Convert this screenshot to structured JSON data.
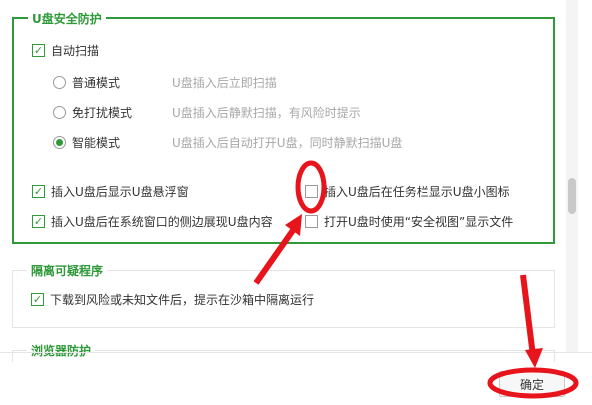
{
  "usb_group": {
    "title": "U盘安全防护",
    "auto_scan": {
      "label": "自动扫描",
      "checked": true
    },
    "modes": [
      {
        "label": "普通模式",
        "hint": "U盘插入后立即扫描",
        "selected": false
      },
      {
        "label": "免打扰模式",
        "hint": "U盘插入后静默扫描，有风险时提示",
        "selected": false
      },
      {
        "label": "智能模式",
        "hint": "U盘插入后自动打开U盘，同时静默扫描U盘",
        "selected": true
      }
    ],
    "options": [
      {
        "label": "插入U盘后显示U盘悬浮窗",
        "checked": true
      },
      {
        "label": "插入U盘后在任务栏显示U盘小图标",
        "checked": false
      },
      {
        "label": "插入U盘后在系统窗口的侧边展现U盘内容",
        "checked": true
      },
      {
        "label": "打开U盘时使用“安全视图”显示文件",
        "checked": false
      }
    ]
  },
  "quarantine_group": {
    "title": "隔离可疑程序",
    "option": {
      "label": "下载到风险或未知文件后，提示在沙箱中隔离运行",
      "checked": true
    }
  },
  "browser_group": {
    "title": "浏览器防护"
  },
  "footer": {
    "ok_label": "确定"
  },
  "colors": {
    "accent": "#2f9a39",
    "annotation": "#e8141c"
  }
}
